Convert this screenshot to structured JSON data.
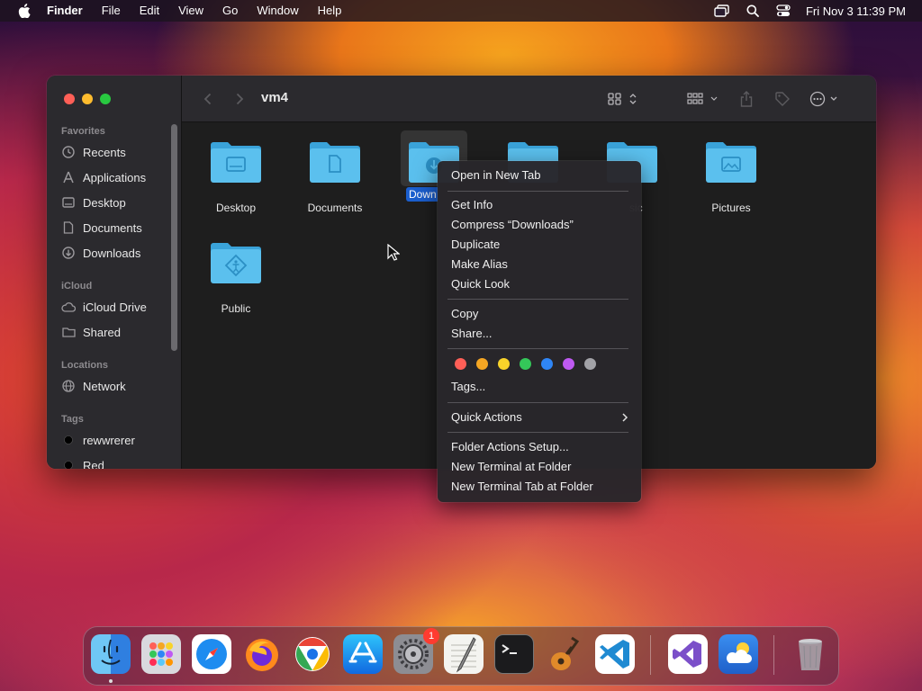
{
  "menubar": {
    "app_name": "Finder",
    "items": [
      "File",
      "Edit",
      "View",
      "Go",
      "Window",
      "Help"
    ],
    "clock": "Fri Nov 3  11:39 PM"
  },
  "window": {
    "title": "vm4",
    "sidebar": {
      "favorites_header": "Favorites",
      "favorites": [
        {
          "label": "Recents",
          "icon": "clock-icon"
        },
        {
          "label": "Applications",
          "icon": "applications-icon"
        },
        {
          "label": "Desktop",
          "icon": "desktop-icon"
        },
        {
          "label": "Documents",
          "icon": "document-icon"
        },
        {
          "label": "Downloads",
          "icon": "download-icon"
        }
      ],
      "icloud_header": "iCloud",
      "icloud": [
        {
          "label": "iCloud Drive",
          "icon": "cloud-icon"
        },
        {
          "label": "Shared",
          "icon": "shared-folder-icon"
        }
      ],
      "locations_header": "Locations",
      "locations": [
        {
          "label": "Network",
          "icon": "globe-icon"
        }
      ],
      "tags_header": "Tags",
      "tags": [
        {
          "label": "rewwrerer",
          "color": "#000000"
        },
        {
          "label": "Red",
          "color": "#000000"
        }
      ]
    },
    "files": [
      {
        "label": "Desktop",
        "glyph": "desktop"
      },
      {
        "label": "Documents",
        "glyph": "document"
      },
      {
        "label": "Down",
        "glyph": "download",
        "selected": true
      },
      {
        "label": "",
        "glyph": "movies"
      },
      {
        "label": "sic",
        "glyph": "music"
      },
      {
        "label": "Pictures",
        "glyph": "pictures"
      },
      {
        "label": "Public",
        "glyph": "public"
      }
    ]
  },
  "context_menu": {
    "items": {
      "open_new_tab": "Open in New Tab",
      "get_info": "Get Info",
      "compress": "Compress “Downloads”",
      "duplicate": "Duplicate",
      "make_alias": "Make Alias",
      "quick_look": "Quick Look",
      "copy": "Copy",
      "share": "Share...",
      "tags": "Tags...",
      "quick_actions": "Quick Actions",
      "folder_actions": "Folder Actions Setup...",
      "new_terminal": "New Terminal at Folder",
      "new_terminal_tab": "New Terminal Tab at Folder"
    },
    "tag_colors": [
      "#ff5f57",
      "#f5a623",
      "#f8d32a",
      "#34c759",
      "#2f86f6",
      "#bf5af2",
      "#a2a2a7"
    ]
  },
  "dock": {
    "apps": [
      "finder-icon",
      "launchpad-icon",
      "safari-icon",
      "firefox-icon",
      "chrome-icon",
      "app-store-icon",
      "system-settings-icon",
      "textedit-icon",
      "terminal-icon",
      "garageband-icon",
      "vscode-icon",
      "visual-studio-icon",
      "weather-icon",
      "trash-icon"
    ],
    "settings_badge": "1"
  }
}
